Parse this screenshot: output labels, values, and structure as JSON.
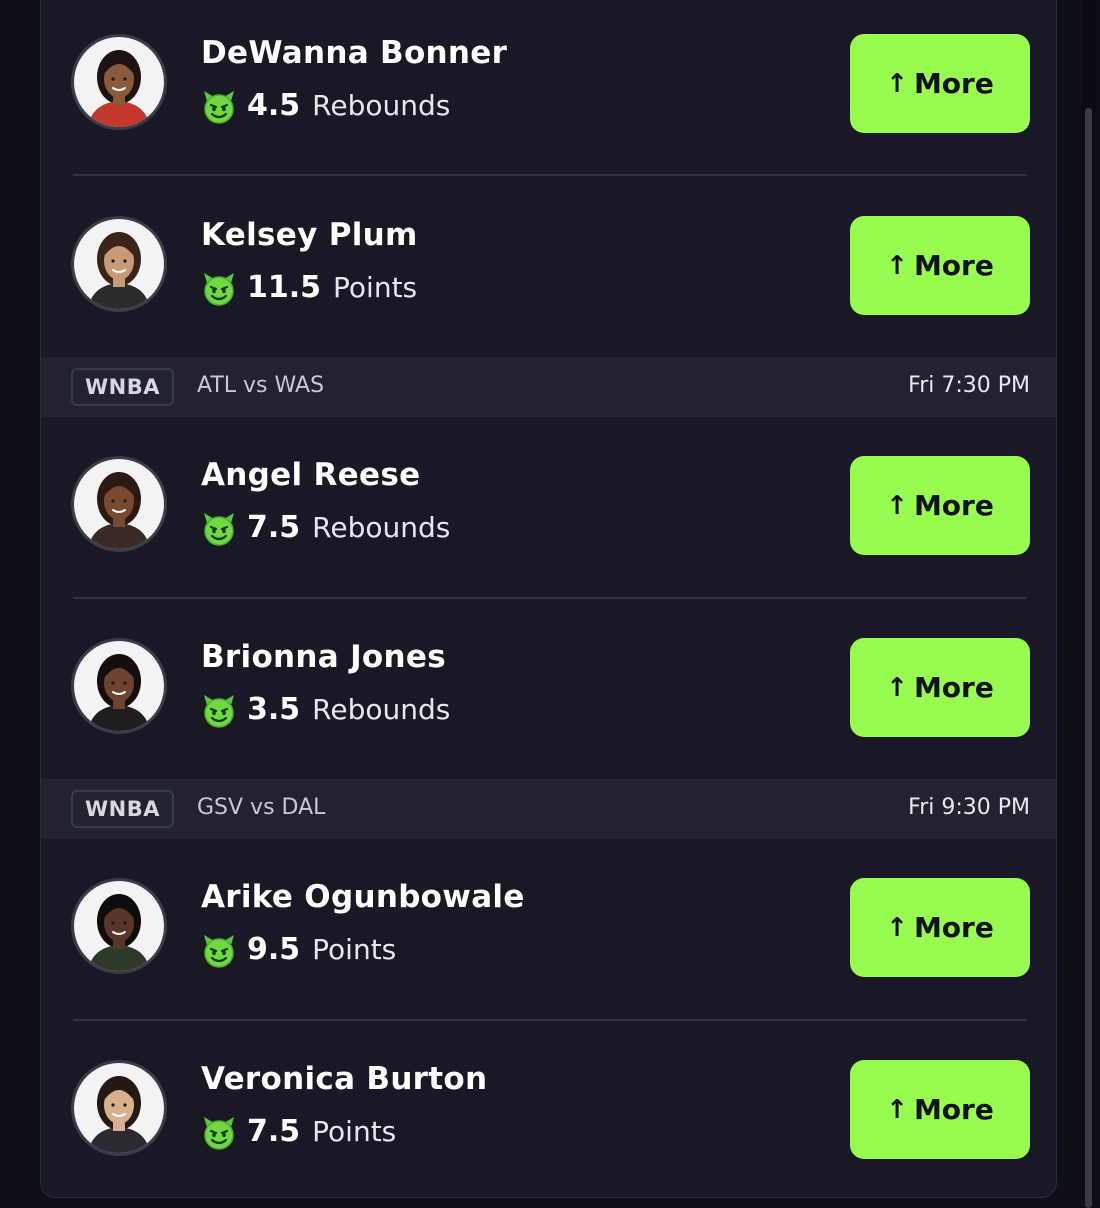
{
  "players": [
    {
      "name": "DeWanna Bonner",
      "value": "4.5",
      "stat": "Rebounds",
      "button": "More",
      "skin": "#8a5a3c",
      "hair": "#1c1410",
      "jersey": "#c0392b"
    },
    {
      "name": "Kelsey Plum",
      "value": "11.5",
      "stat": "Points",
      "button": "More",
      "skin": "#c99a78",
      "hair": "#3a2418",
      "jersey": "#2b2b2b"
    },
    {
      "name": "Angel Reese",
      "value": "7.5",
      "stat": "Rebounds",
      "button": "More",
      "skin": "#7a4a30",
      "hair": "#2a1a12",
      "jersey": "#3a2a26"
    },
    {
      "name": "Brionna Jones",
      "value": "3.5",
      "stat": "Rebounds",
      "button": "More",
      "skin": "#6e4430",
      "hair": "#140e0c",
      "jersey": "#1e1e1e"
    },
    {
      "name": "Arike Ogunbowale",
      "value": "9.5",
      "stat": "Points",
      "button": "More",
      "skin": "#5a3626",
      "hair": "#0f0c0b",
      "jersey": "#2c3a2a"
    },
    {
      "name": "Veronica Burton",
      "value": "7.5",
      "stat": "Points",
      "button": "More",
      "skin": "#d8b08e",
      "hair": "#231812",
      "jersey": "#2a2a30"
    }
  ],
  "games": [
    {
      "league": "WNBA",
      "matchup": "ATL vs WAS",
      "time": "Fri 7:30 PM"
    },
    {
      "league": "WNBA",
      "matchup": "GSV vs DAL",
      "time": "Fri 9:30 PM"
    }
  ],
  "icons": {
    "stat_icon": "devil-icon",
    "button_icon": "arrow-up-icon"
  },
  "colors": {
    "accent": "#98fb4f",
    "background": "#181924",
    "header": "#22232e"
  }
}
